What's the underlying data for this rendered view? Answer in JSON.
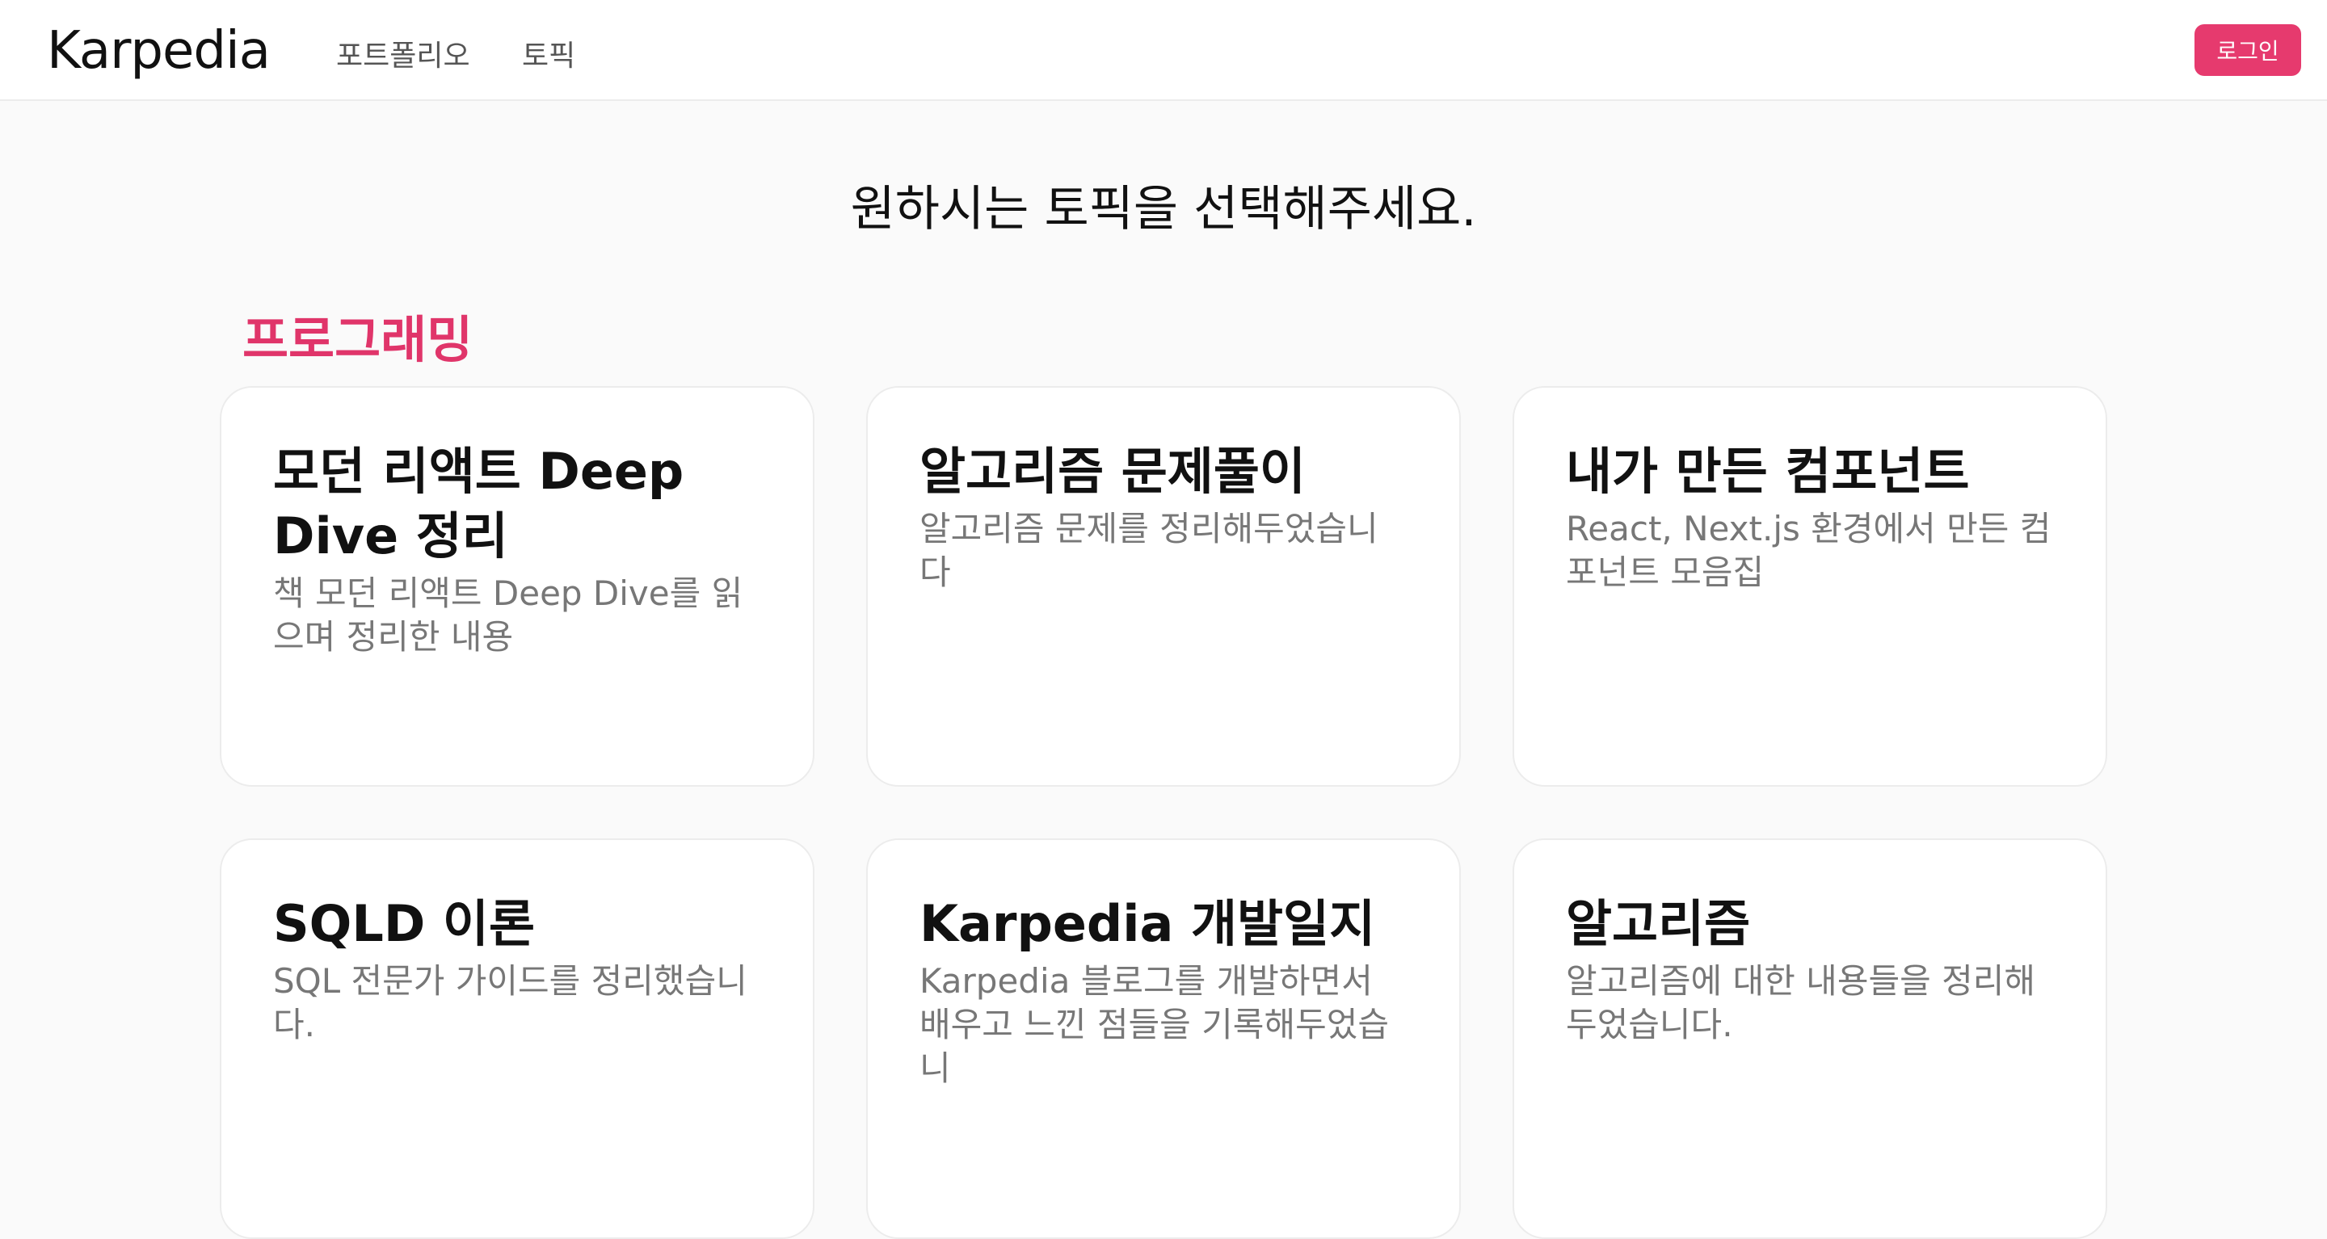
{
  "header": {
    "brand": "Karpedia",
    "nav": [
      {
        "label": "포트폴리오"
      },
      {
        "label": "토픽"
      }
    ],
    "login_label": "로그인"
  },
  "main": {
    "heading": "원하시는 토픽을 선택해주세요.",
    "section_title": "프로그래밍",
    "cards": [
      {
        "title": "모던 리액트 Deep Dive 정리",
        "description": "책 모던 리액트 Deep Dive를 읽으며 정리한 내용"
      },
      {
        "title": "알고리즘 문제풀이",
        "description": "알고리즘 문제를 정리해두었습니다"
      },
      {
        "title": "내가 만든 컴포넌트",
        "description": "React, Next.js 환경에서 만든 컴포넌트 모음집"
      },
      {
        "title": "SQLD 이론",
        "description": "SQL 전문가 가이드를 정리했습니다."
      },
      {
        "title": "Karpedia 개발일지",
        "description": "Karpedia 블로그를 개발하면서 배우고 느낀 점들을 기록해두었습니"
      },
      {
        "title": "알고리즘",
        "description": "알고리즘에 대한 내용들을 정리해두었습니다."
      }
    ]
  },
  "colors": {
    "accent": "#e63a6e",
    "section_title": "#e0356a",
    "background": "#fafafa"
  }
}
